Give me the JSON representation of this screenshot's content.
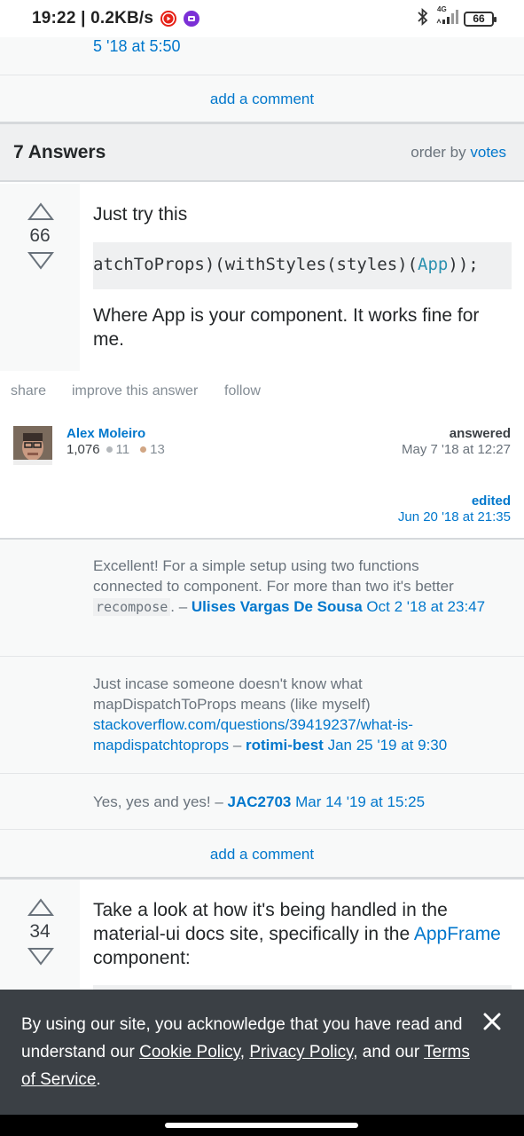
{
  "status_bar": {
    "time": "19:22 | 0.2KB/s",
    "network": "4G",
    "battery": "66"
  },
  "top_comment": {
    "date_tail": "5 '18 at 5:50"
  },
  "add_comment_label": "add a comment",
  "answers_header": {
    "count": "7 Answers",
    "order_prefix": "order by",
    "order_value": "votes"
  },
  "answer1": {
    "votes": "66",
    "intro": "Just try this",
    "code_before": "atchToProps)(withStyles(styles)(",
    "code_highlight": "App",
    "code_after": "));",
    "body": "Where App is your component. It works fine for me."
  },
  "actions": {
    "share": "share",
    "improve": "improve this answer",
    "follow": "follow"
  },
  "author": {
    "name": "Alex Moleiro",
    "rep": "1,076",
    "silver": "11",
    "bronze": "13",
    "answered_label": "answered",
    "answered_date": "May 7 '18 at 12:27"
  },
  "edited": {
    "label": "edited",
    "date": "Jun 20 '18 at 21:35"
  },
  "comments": [
    {
      "text_a": "Excellent! For a simple setup using two functions connected to component. For more than two it's better ",
      "code": "recompose",
      "text_b": ". – ",
      "author": "Ulises Vargas De Sousa",
      "date": "Oct 2 '18 at 23:47"
    },
    {
      "text_a": "Just incase someone doesn't know what mapDispatchToProps means (like myself) ",
      "link": "stackoverflow.com/questions/39419237/what-is-mapdispatchtoprops",
      "text_b": " – ",
      "author": "rotimi-best",
      "date": "Jan 25 '19 at 9:30"
    },
    {
      "text_a": "Yes, yes and yes! – ",
      "author": "JAC2703",
      "date": "Mar 14 '19 at 15:25"
    }
  ],
  "answer2": {
    "votes": "34",
    "text_a": "Take a look at how it's being handled in the material-ui docs site, specifically in the ",
    "link": "AppFrame",
    "text_b": " component:"
  },
  "cookie": {
    "text_a": "By using our site, you acknowledge that you have read and understand our ",
    "cookie_policy": "Cookie Policy",
    "sep1": ", ",
    "privacy_policy": "Privacy Policy",
    "sep2": ", and our ",
    "terms": "Terms of Service",
    "end": "."
  },
  "colors": {
    "link": "#0077cc",
    "banner": "#3b4045",
    "bronze": "#d1a684",
    "silver": "#b4b8bc"
  }
}
